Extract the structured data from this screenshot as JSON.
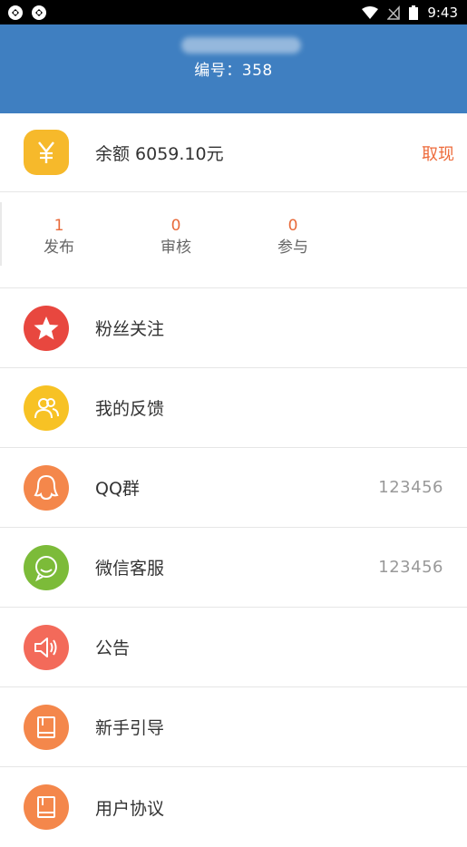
{
  "status_bar": {
    "time": "9:43",
    "left_icons": [
      "app-icon",
      "app-icon"
    ],
    "right_icons": [
      "wifi-icon",
      "no-signal-icon",
      "battery-icon"
    ]
  },
  "header": {
    "user_id_label": "编号：358",
    "background_color": "#3f7fc1"
  },
  "balance": {
    "icon": "yuan-icon",
    "icon_color": "#f6b92b",
    "text": "余额 6059.10元",
    "withdraw_label": "取现",
    "withdraw_color": "#ee6b3b"
  },
  "stats": [
    {
      "value": "1",
      "label": "发布"
    },
    {
      "value": "0",
      "label": "审核"
    },
    {
      "value": "0",
      "label": "参与"
    }
  ],
  "menu": [
    {
      "icon": "star-icon",
      "icon_color": "#e8473f",
      "label": "粉丝关注",
      "value": ""
    },
    {
      "icon": "users-icon",
      "icon_color": "#f7c224",
      "label": "我的反馈",
      "value": ""
    },
    {
      "icon": "qq-icon",
      "icon_color": "#f4874b",
      "label": "QQ群",
      "value": "123456"
    },
    {
      "icon": "wechat-icon",
      "icon_color": "#7cbb39",
      "label": "微信客服",
      "value": "123456"
    },
    {
      "icon": "speaker-icon",
      "icon_color": "#f36a5a",
      "label": "公告",
      "value": ""
    },
    {
      "icon": "book-icon",
      "icon_color": "#f4874b",
      "label": "新手引导",
      "value": ""
    },
    {
      "icon": "book-icon",
      "icon_color": "#f4874b",
      "label": "用户协议",
      "value": ""
    }
  ]
}
